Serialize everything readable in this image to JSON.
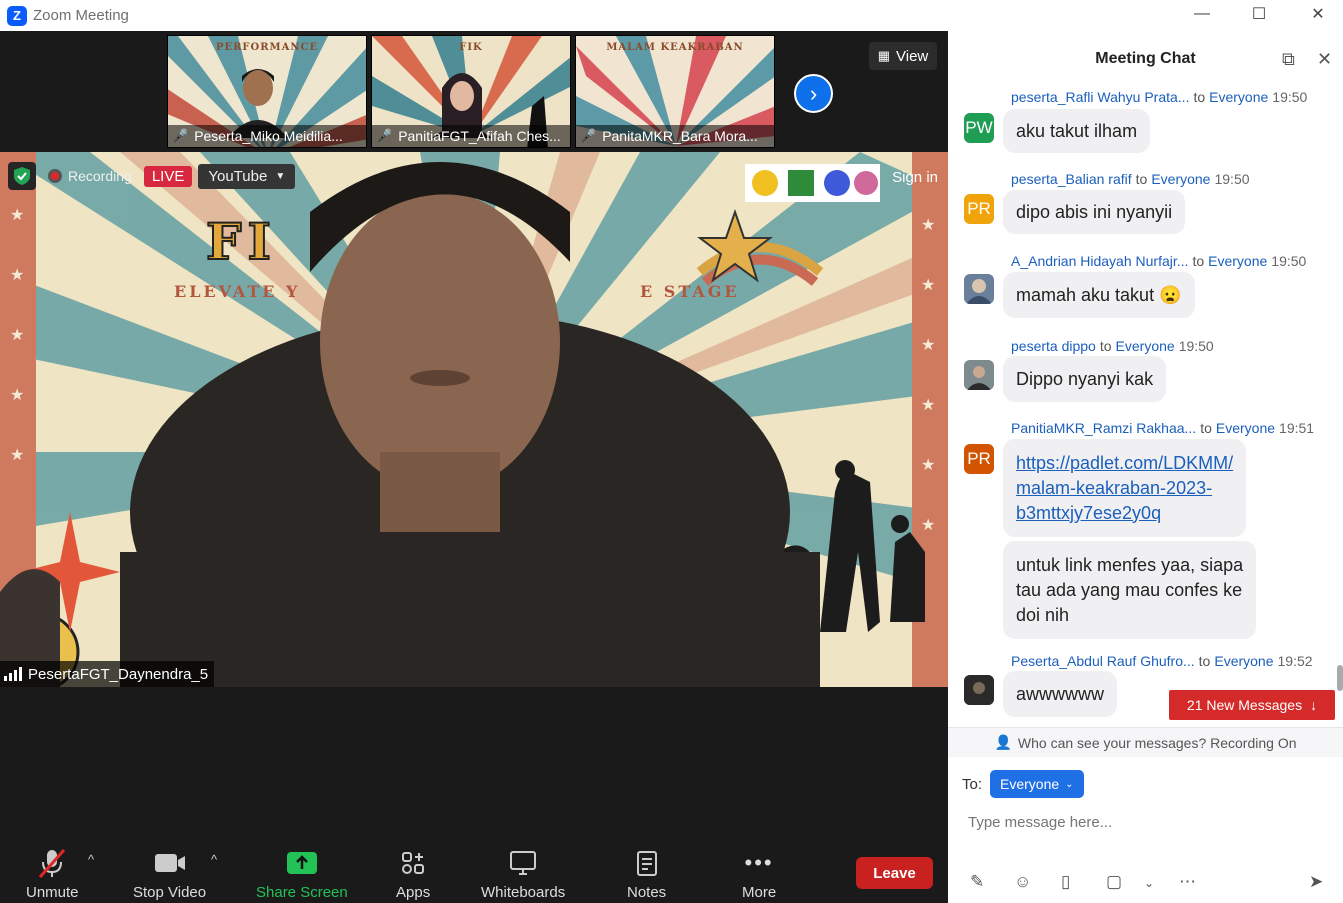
{
  "window": {
    "title": "Zoom Meeting",
    "logo": "Z",
    "minimize": "—",
    "maximize": "☐",
    "close": "✕"
  },
  "thumbnails": [
    {
      "name": "Peserta_Miko Meidilia...",
      "banner": "PERFORMANCE"
    },
    {
      "name": "PanitiaFGT_Afifah Ches...",
      "banner": "FIK"
    },
    {
      "name": "PanitaMKR_Bara Mora...",
      "banner": "MALAM KEAKRABAN"
    }
  ],
  "view_label": "View",
  "main": {
    "recording_label": "Recording",
    "live_label": "LIVE",
    "youtube_label": "YouTube",
    "signin_label": "Sign in",
    "speaker_name": "PesertaFGT_Daynendra_5",
    "bg_title": "FI",
    "bg_subtitle_left": "ELEVATE Y",
    "bg_subtitle_right": "E STAGE"
  },
  "toolbar": {
    "unmute": "Unmute",
    "stop_video": "Stop Video",
    "share_screen": "Share Screen",
    "apps": "Apps",
    "whiteboards": "Whiteboards",
    "notes": "Notes",
    "more": "More",
    "leave": "Leave"
  },
  "chat": {
    "title": "Meeting Chat",
    "to_word": "to",
    "messages": [
      {
        "sender": "peserta_Rafli Wahyu Prata...",
        "to": "Everyone",
        "time": "19:50",
        "initials": "PW",
        "color": "#1f9d55",
        "text": "aku takut ilham"
      },
      {
        "sender": "peserta_Balian rafif",
        "to": "Everyone",
        "time": "19:50",
        "initials": "PR",
        "color": "#f0a30a",
        "text": "dipo abis ini nyanyii"
      },
      {
        "sender": "A_Andrian Hidayah Nurfajr...",
        "to": "Everyone",
        "time": "19:50",
        "initials": "",
        "color": "#6a7f99",
        "text": "mamah aku takut",
        "emoji": "😦"
      },
      {
        "sender": "peserta dippo",
        "to": "Everyone",
        "time": "19:50",
        "initials": "",
        "color": "#8a8a8a",
        "text": "Dippo nyanyi kak"
      },
      {
        "sender": "PanitiaMKR_Ramzi Rakhaa...",
        "to": "Everyone",
        "time": "19:51",
        "initials": "PR",
        "color": "#d35400",
        "link_lines": [
          "https://padlet.com/LDKMM/",
          "malam-keakraban-2023-",
          "b3mttxjy7ese2y0q"
        ],
        "followup_lines": [
          "untuk link menfes yaa, siapa",
          "tau ada yang mau confes ke",
          "doi nih"
        ]
      },
      {
        "sender": "Peserta_Abdul Rauf Ghufro...",
        "to": "Everyone",
        "time": "19:52",
        "initials": "",
        "color": "#3a3a3a",
        "text": "awwwwww"
      }
    ],
    "new_messages": "21 New Messages",
    "privacy_notice": "Who can see your messages? Recording On",
    "to_label": "To:",
    "recipient": "Everyone",
    "placeholder": "Type message here..."
  }
}
